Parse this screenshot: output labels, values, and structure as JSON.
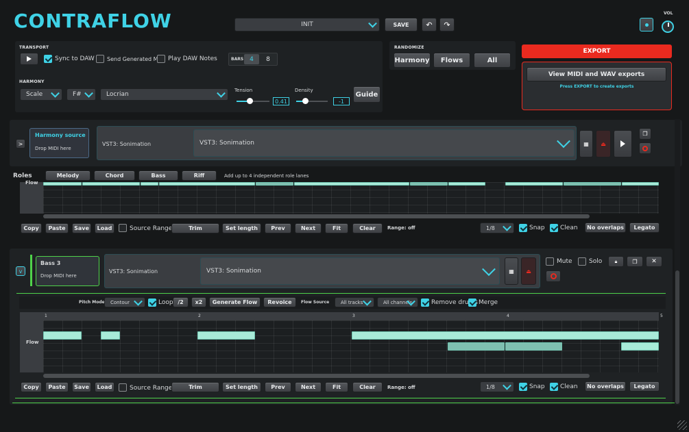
{
  "app": {
    "logo": "CONTRAFLOW",
    "vol_label": "VOL"
  },
  "preset": {
    "name": "INIT",
    "save": "SAVE"
  },
  "transport": {
    "title": "TRANSPORT",
    "sync": "Sync to DAW",
    "send_midi": "Send Generated MIDI",
    "play_notes": "Play DAW Notes",
    "bars_label": "BARS",
    "bars_4": "4",
    "bars_8": "8"
  },
  "randomize": {
    "title": "RANDOMIZE",
    "harmony": "Harmony",
    "flows": "Flows",
    "all": "All"
  },
  "export": {
    "button": "EXPORT",
    "view": "View MIDI and WAV exports",
    "hint": "Press EXPORT to create exports"
  },
  "harmony": {
    "title": "HARMONY",
    "scale": "Scale",
    "key": "F#",
    "mode": "Locrian",
    "tension_label": "Tension",
    "tension_value": "0.41",
    "density_label": "Density",
    "density_value": "-1",
    "guide": "Guide"
  },
  "harmony_source": {
    "title": "Harmony source",
    "drop": "Drop MIDI here",
    "plugin_short": "VST3: Sonimation",
    "plugin": "VST3: Sonimation",
    "expand": ">"
  },
  "roles": {
    "title": "Roles",
    "tabs": [
      "Melody",
      "Chord",
      "Bass",
      "Riff"
    ],
    "hint": "Add up to 4 independent role lanes",
    "lane_label": "Flow"
  },
  "toolbar": {
    "copy": "Copy",
    "paste": "Paste",
    "save": "Save",
    "load": "Load",
    "source_range": "Source Range",
    "trim": "Trim",
    "set_length": "Set length",
    "prev": "Prev",
    "next": "Next",
    "fit": "Fit",
    "clear": "Clear",
    "range": "Range: off",
    "quant": "1/8",
    "snap": "Snap",
    "clean": "Clean",
    "no_overlaps": "No overlaps",
    "legato": "Legato"
  },
  "bass": {
    "title": "Bass 3",
    "drop": "Drop MIDI here",
    "plugin_short": "VST3: Sonimation",
    "plugin": "VST3: Sonimation",
    "mute": "Mute",
    "solo": "Solo",
    "collapse": "v"
  },
  "flow_controls": {
    "pitch_mode_label": "Pitch Mode",
    "pitch_mode": "Contour",
    "loop": "Loop",
    "div2": "/2",
    "x2": "x2",
    "generate": "Generate Flow",
    "revoice": "Revoice",
    "flow_source_label": "Flow Source",
    "tracks": "All tracks",
    "channels": "All channels",
    "remove_drums": "Remove drums",
    "merge": "Merge"
  },
  "ruler": [
    "1",
    "2",
    "3",
    "4",
    "5"
  ],
  "lane_label": "Flow",
  "colors": {
    "accent": "#3fd2e6",
    "export": "#ea2a1f",
    "note": "#a8ead8",
    "green": "#4fd34a"
  }
}
